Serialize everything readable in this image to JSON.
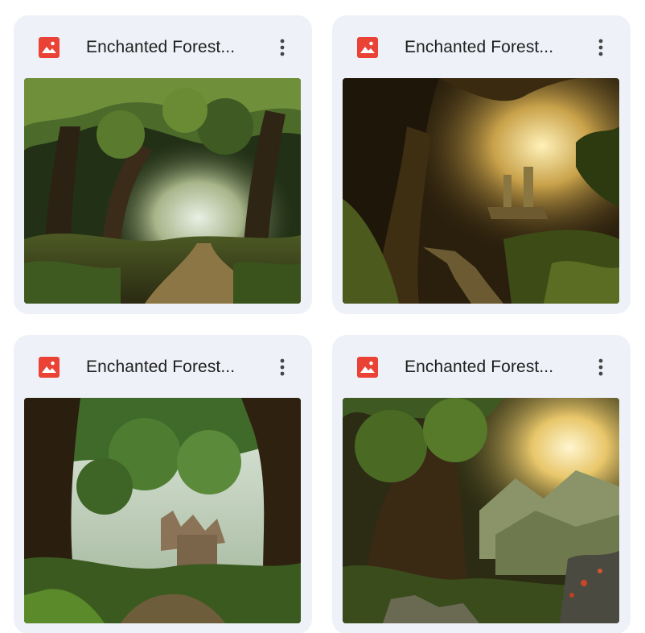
{
  "files": [
    {
      "title": "Enchanted Forest...",
      "icon": "image-file-icon",
      "thumbnail": "forest-path-thumbnail"
    },
    {
      "title": "Enchanted Forest...",
      "icon": "image-file-icon",
      "thumbnail": "forest-stairs-thumbnail"
    },
    {
      "title": "Enchanted Forest...",
      "icon": "image-file-icon",
      "thumbnail": "forest-ruins-thumbnail"
    },
    {
      "title": "Enchanted Forest...",
      "icon": "image-file-icon",
      "thumbnail": "forest-mountains-thumbnail"
    }
  ],
  "colors": {
    "card_background": "#eef1f7",
    "image_icon": "#ea4335",
    "title_text": "#1f1f1f",
    "menu_icon": "#444746"
  }
}
